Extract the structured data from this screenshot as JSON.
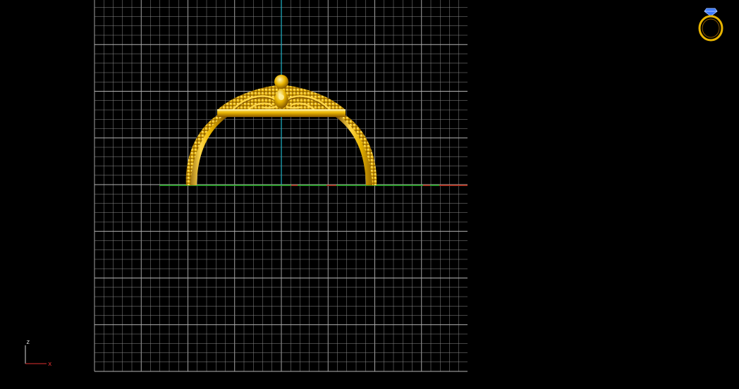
{
  "viewport": {
    "background": "#000000",
    "grid_color": "#8a8a8a",
    "grid_major_color": "#b4b4b4",
    "vertical_axis_color": "#1fb3c8",
    "horizontal_axis_color": "#22b422",
    "horizontal_axis_accent_color": "#d42020",
    "model_color": "#e8b400",
    "model_highlight": "#ffe066",
    "model_shadow": "#8a5a00"
  },
  "axis_triad": {
    "z_label": "z",
    "x_label": "x",
    "z_color": "#d8d8d8",
    "x_color": "#e03030"
  },
  "nav_cube": {
    "icon": "ring-view-icon",
    "gem_color": "#3a78ff",
    "band_color": "#e8b400"
  }
}
